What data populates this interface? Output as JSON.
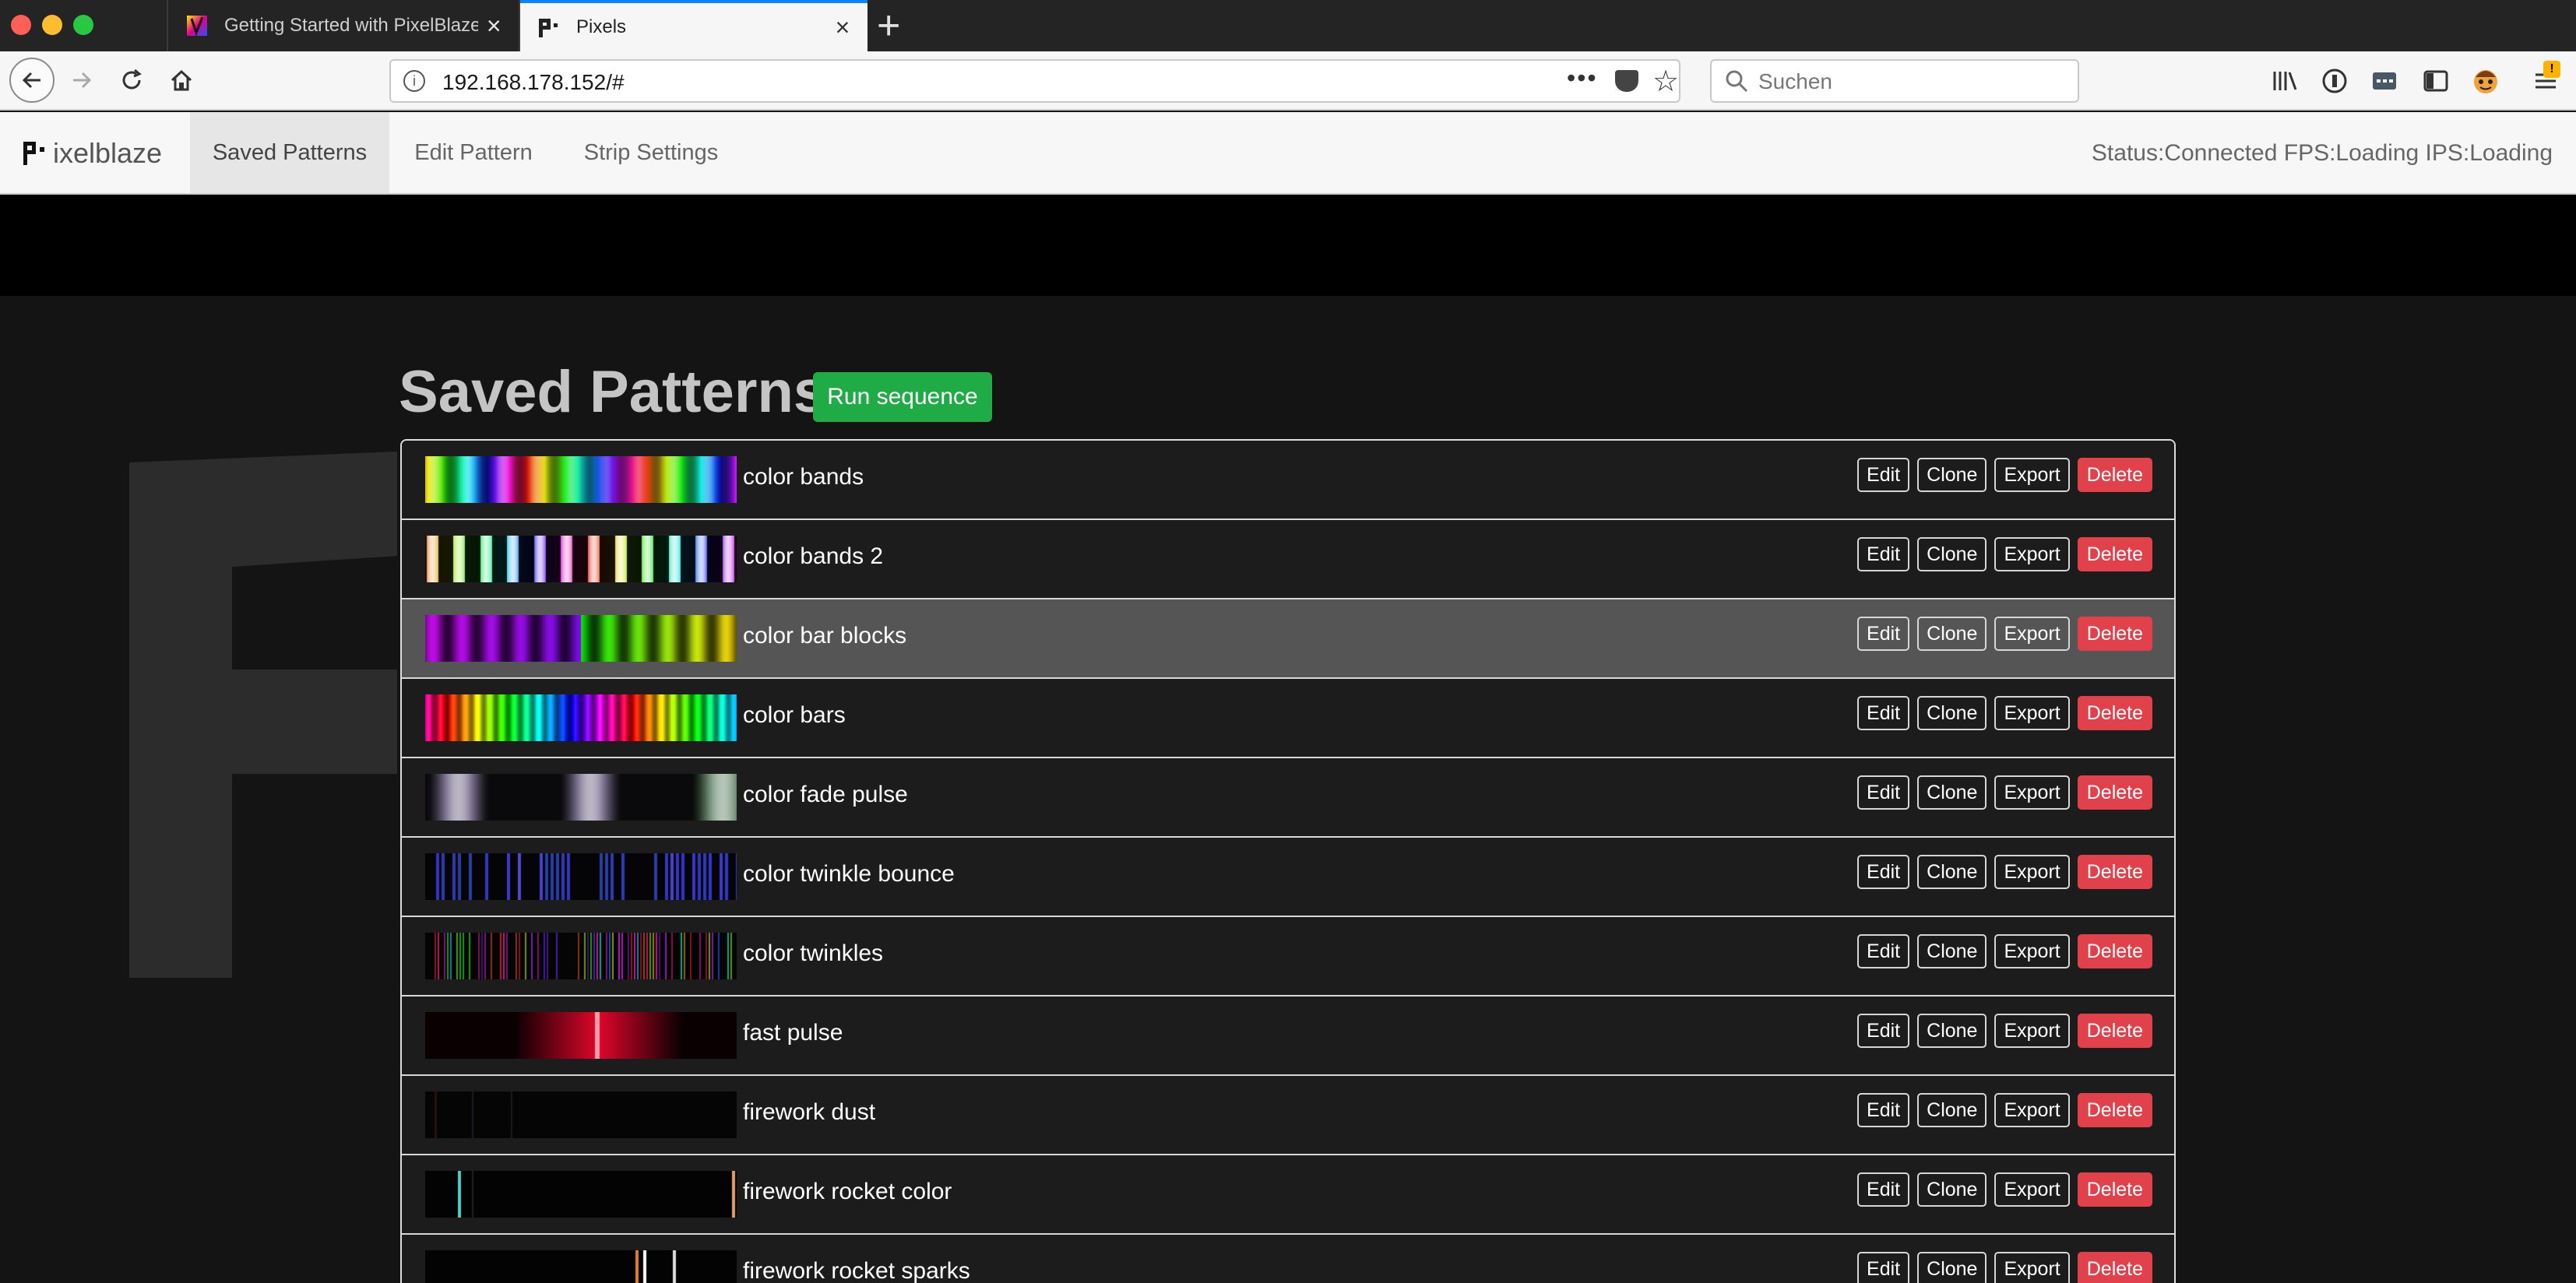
{
  "browser": {
    "tabs": [
      {
        "title": "Getting Started with PixelBlaze",
        "active": false
      },
      {
        "title": "Pixels",
        "active": true
      }
    ],
    "url": "192.168.178.152/#",
    "search_placeholder": "Suchen",
    "badge": "!"
  },
  "app": {
    "brand": "ixelblaze",
    "nav": [
      {
        "label": "Saved Patterns",
        "active": true
      },
      {
        "label": "Edit Pattern",
        "active": false
      },
      {
        "label": "Strip Settings",
        "active": false
      }
    ],
    "status": "Status:Connected FPS:Loading IPS:Loading"
  },
  "page": {
    "title": "Saved Patterns",
    "run_sequence": "Run sequence"
  },
  "actions": {
    "edit": "Edit",
    "clone": "Clone",
    "export": "Export",
    "delete": "Delete"
  },
  "patterns": [
    {
      "name": "color bands",
      "preview": "bands"
    },
    {
      "name": "color bands 2",
      "preview": "bands2"
    },
    {
      "name": "color bar blocks",
      "preview": "blocks",
      "highlight": true
    },
    {
      "name": "color bars",
      "preview": "rainbow"
    },
    {
      "name": "color fade pulse",
      "preview": "fade"
    },
    {
      "name": "color twinkle bounce",
      "preview": "twinkleblue"
    },
    {
      "name": "color twinkles",
      "preview": "twinkles"
    },
    {
      "name": "fast pulse",
      "preview": "pulse"
    },
    {
      "name": "firework dust",
      "preview": "dust"
    },
    {
      "name": "firework rocket color",
      "preview": "rocket"
    },
    {
      "name": "firework rocket sparks",
      "preview": "sparks"
    }
  ],
  "colors": {
    "accent_green": "#1fab45",
    "danger_red": "#e0414b",
    "tab_accent": "#0a84ff"
  }
}
